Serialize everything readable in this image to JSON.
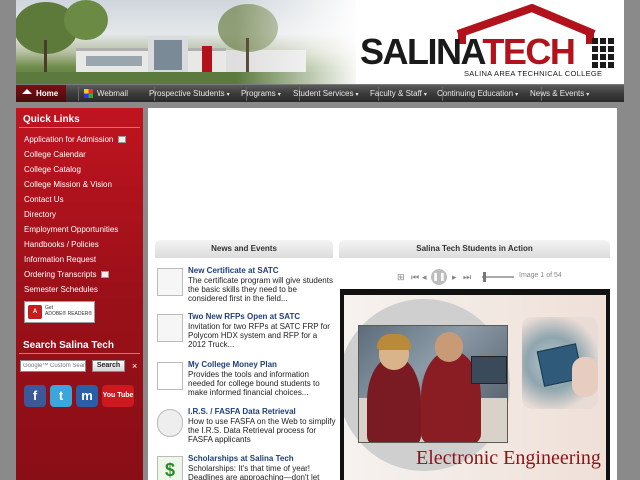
{
  "header": {
    "logo_salina": "SALINA",
    "logo_tech": "TECH",
    "logo_tagline": "SALINA AREA TECHNICAL COLLEGE",
    "campus_image": "campus-building-photo"
  },
  "nav": {
    "items": [
      {
        "label": "Home",
        "icon": "home-icon"
      },
      {
        "label": "Webmail",
        "icon": "webmail-icon"
      },
      {
        "label": "Prospective Students"
      },
      {
        "label": "Programs"
      },
      {
        "label": "Student Services"
      },
      {
        "label": "Faculty & Staff"
      },
      {
        "label": "Continuing Education"
      },
      {
        "label": "News & Events"
      }
    ]
  },
  "sidebar": {
    "quick_links_title": "Quick Links",
    "links": [
      "Application for Admission",
      "College Calendar",
      "College Catalog",
      "College Mission & Vision",
      "Contact Us",
      "Directory",
      "Employment Opportunities",
      "Handbooks / Policies",
      "Information Request",
      "Ordering Transcripts",
      "Semester Schedules"
    ],
    "adobe": {
      "line1": "Get",
      "line2": "ADOBE® READER®"
    },
    "search_title": "Search Salina Tech",
    "search_placeholder": "Google™ Custom Search",
    "search_button": "Search",
    "search_clear": "×",
    "social": [
      {
        "name": "facebook",
        "glyph": "f"
      },
      {
        "name": "twitter",
        "glyph": "t"
      },
      {
        "name": "myspace",
        "glyph": "m"
      },
      {
        "name": "youtube",
        "glyph": "You Tube"
      }
    ]
  },
  "news": {
    "title": "News and Events",
    "items": [
      {
        "title": "New Certificate at SATC",
        "desc": "The certificate program will give students the basic skills they need to be considered first in the field..."
      },
      {
        "title": "Two New RFPs Open at SATC",
        "desc": "Invitation for two RFPs at SATC FRP for Polycom HDX system and RFP for a 2012 Truck..."
      },
      {
        "title": "My College Money Plan",
        "desc": "Provides the tools and information needed for college bound students to make informed financial choices..."
      },
      {
        "title": "I.R.S. / FASFA Data Retrieval",
        "desc": "How to use FASFA on the Web to simplify the I.R.S. Data Retrieval process for FASFA applicants"
      },
      {
        "title": "Scholarships at Salina Tech",
        "desc": "Scholarships: It's that time of year! Deadlines are approaching—don't let"
      }
    ]
  },
  "students": {
    "title": "Salina Tech Students in Action",
    "image_counter": "Image 1 of 54",
    "slide_caption": "Electronic Engineering",
    "progress": 0.02
  },
  "colors": {
    "brand_red": "#b1121b",
    "sidebar_red": "#9b1019",
    "nav_dark": "#3b3b3b",
    "news_link": "#1e3f7a"
  }
}
